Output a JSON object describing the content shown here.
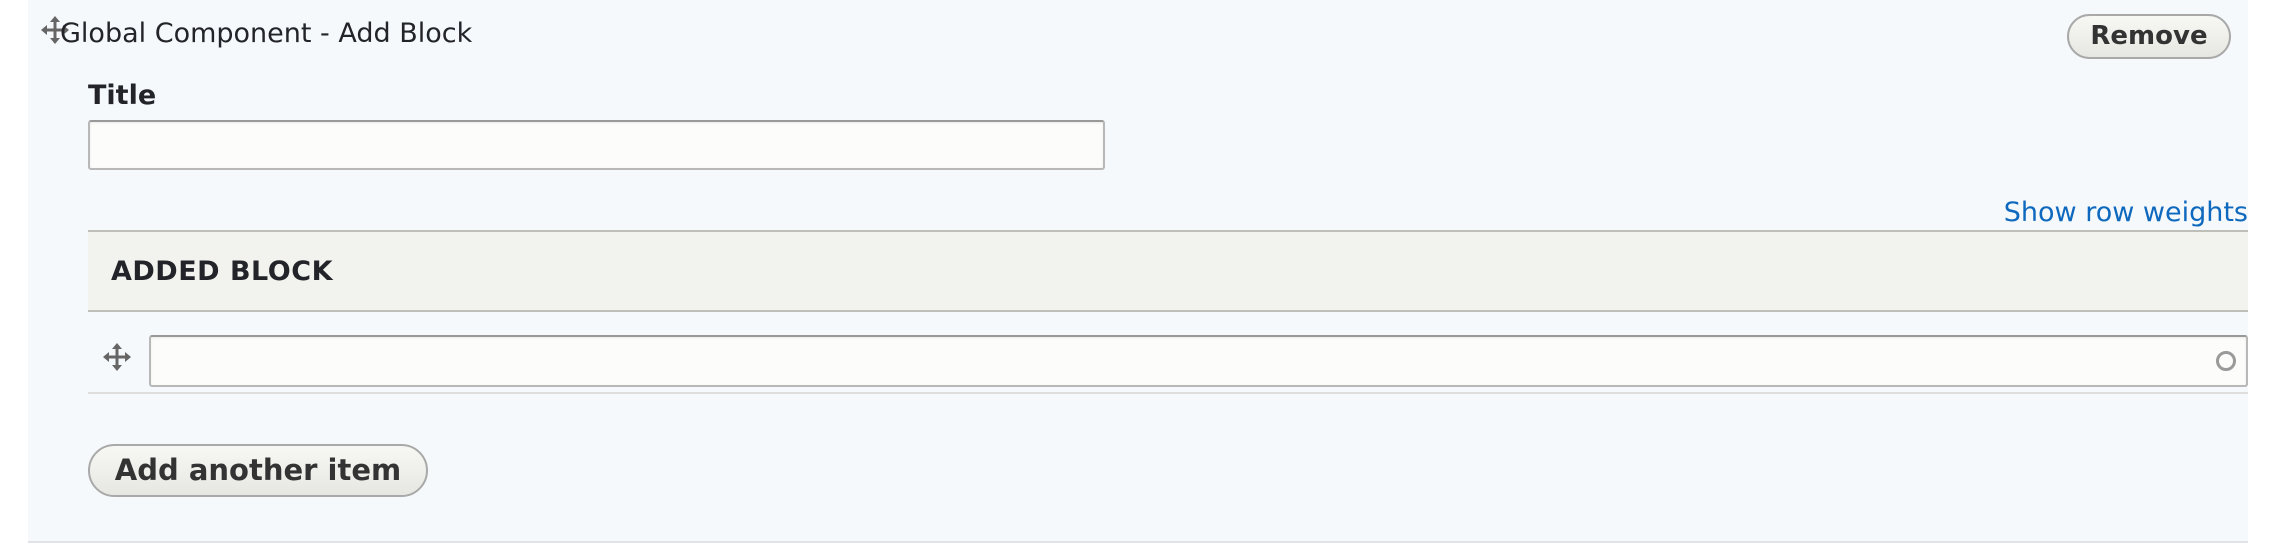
{
  "component": {
    "title": "Global Component - Add Block",
    "remove_label": "Remove"
  },
  "title_field": {
    "label": "Title",
    "value": "",
    "placeholder": ""
  },
  "row_weights_link": "Show row weights",
  "table": {
    "header": "ADDED BLOCK",
    "rows": [
      {
        "value": "",
        "placeholder": ""
      }
    ]
  },
  "add_another_label": "Add another item",
  "icons": {
    "drag_handle": "move-arrows-icon",
    "autocomplete_status": "throbber-icon"
  }
}
